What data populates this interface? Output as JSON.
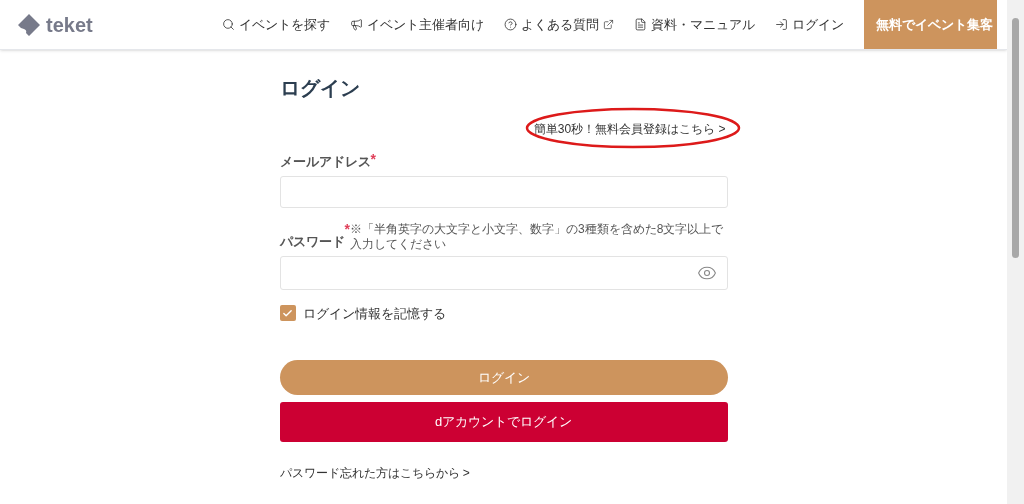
{
  "header": {
    "logo": "teket",
    "nav": [
      {
        "label": "イベントを探す",
        "kind": "search",
        "external": false
      },
      {
        "label": "イベント主催者向け",
        "kind": "megaphone",
        "external": false
      },
      {
        "label": "よくある質問",
        "kind": "help",
        "external": true
      },
      {
        "label": "資料・マニュアル",
        "kind": "document",
        "external": false
      },
      {
        "label": "ログイン",
        "kind": "login",
        "external": false
      }
    ],
    "cta": "無料でイベント集客"
  },
  "form": {
    "title": "ログイン",
    "register_link": {
      "label": "簡単30秒！無料会員登録はこちら >",
      "circled": true
    },
    "email": {
      "label": "メールアドレス",
      "required_mark": "*"
    },
    "password": {
      "label": "パスワード",
      "required_mark": "*",
      "hint": "※「半角英字の大文字と小文字、数字」の3種類を含めた8文字以上で入力してください"
    },
    "remember": {
      "label": "ログイン情報を記憶する",
      "checked": true
    },
    "login_button": "ログイン",
    "d_login_button": "dアカウントでログイン",
    "forgot_link": "パスワード忘れた方はこちらから >"
  }
}
